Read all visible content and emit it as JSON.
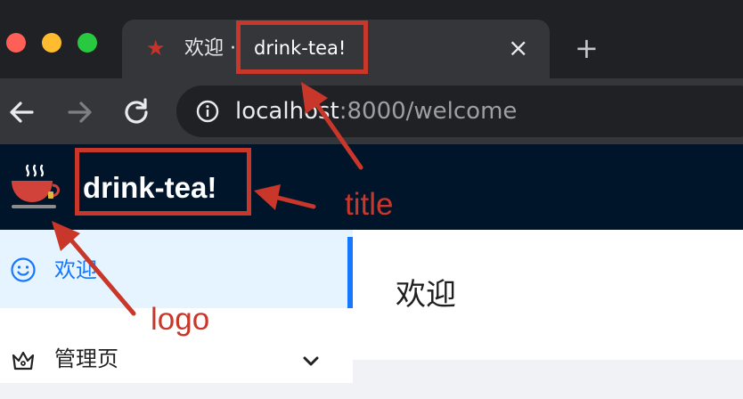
{
  "browser": {
    "tab": {
      "title_prefix": "欢迎 ·",
      "title": "drink-tea!",
      "close_glyph": "×"
    },
    "new_tab_glyph": "+",
    "url": {
      "host": "localhost",
      "rest": ":8000/welcome"
    }
  },
  "app": {
    "title": "drink-tea!"
  },
  "sidebar": {
    "items": [
      {
        "label": "欢迎",
        "icon": "smile-icon",
        "selected": true
      },
      {
        "label": "管理页",
        "icon": "crown-icon",
        "selected": false,
        "expandable": true
      }
    ]
  },
  "content": {
    "page_title": "欢迎"
  },
  "annotations": {
    "title_label": "title",
    "logo_label": "logo",
    "color": "#c8372a"
  },
  "colors": {
    "header_bg": "#001529",
    "accent": "#1677ff",
    "selected_bg": "#e6f4ff"
  }
}
